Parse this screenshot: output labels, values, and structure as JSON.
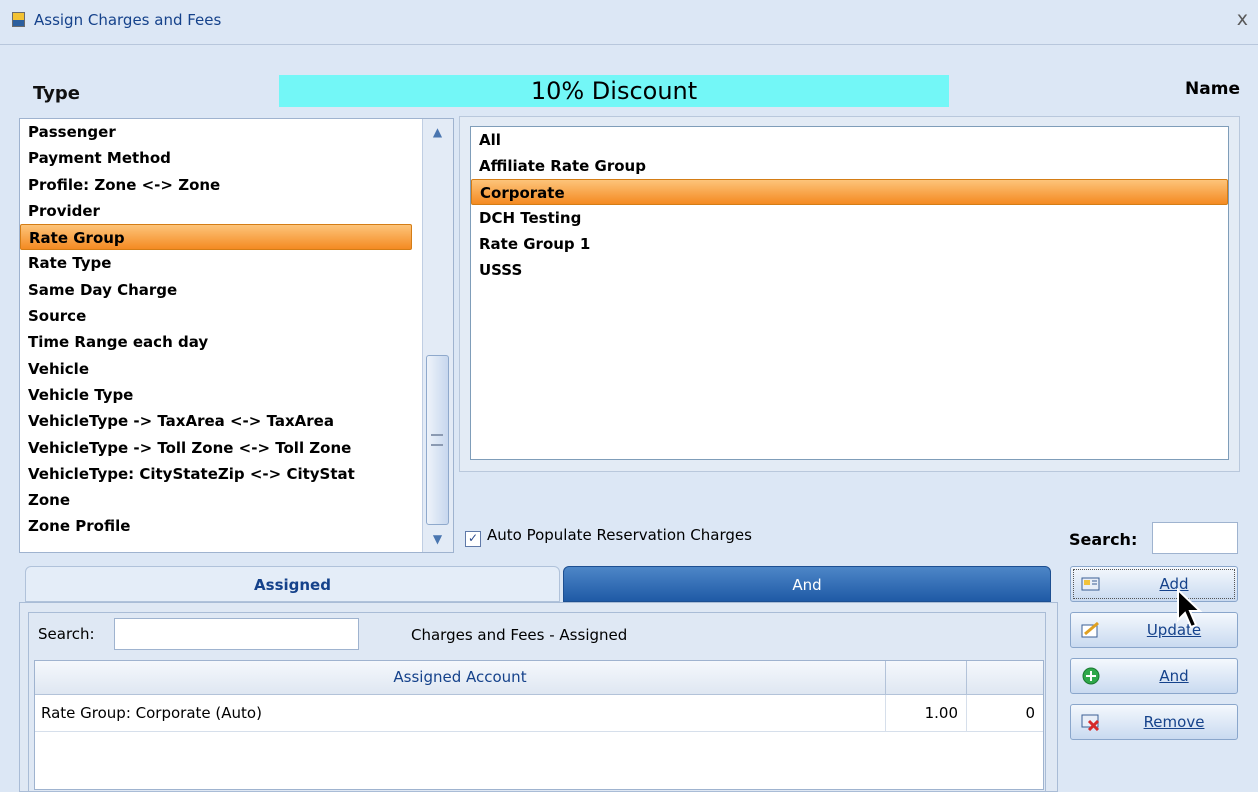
{
  "window": {
    "title": "Assign Charges and Fees",
    "close": "x"
  },
  "header": {
    "type_label": "Type",
    "banner": "10% Discount",
    "name_label": "Name"
  },
  "type_list": {
    "items": [
      "Passenger",
      "Payment Method",
      "Profile: Zone <-> Zone",
      "Provider",
      "Rate Group",
      "Rate Type",
      "Same Day Charge",
      "Source",
      "Time Range each day",
      "Vehicle",
      "Vehicle Type",
      "VehicleType -> TaxArea <-> TaxArea",
      "VehicleType -> Toll Zone <-> Toll Zone",
      "VehicleType: CityStateZip <-> CityStat",
      "Zone",
      "Zone Profile"
    ],
    "selected": "Rate Group"
  },
  "name_list": {
    "items": [
      "All",
      "Affiliate Rate Group",
      "Corporate",
      "DCH Testing",
      "Rate Group 1",
      "USSS"
    ],
    "selected": "Corporate"
  },
  "auto_populate": {
    "label": "Auto Populate Reservation Charges",
    "checked": true
  },
  "search_top": {
    "label": "Search:",
    "value": ""
  },
  "tabs": {
    "assigned": "Assigned",
    "and": "And"
  },
  "assigned_panel": {
    "search_label": "Search:",
    "search_value": "",
    "title": "Charges and Fees - Assigned",
    "columns": [
      "Assigned Account",
      "",
      ""
    ],
    "rows": [
      {
        "account": "Rate Group: Corporate (Auto)",
        "amount": "1.00",
        "count": "0"
      }
    ]
  },
  "buttons": {
    "add": "Add",
    "update": "Update",
    "and": "And",
    "remove": "Remove"
  },
  "icons": {
    "window": "app-icon",
    "add": "add-card-icon",
    "update": "edit-icon",
    "and": "plus-circle-icon",
    "remove": "remove-card-icon"
  },
  "colors": {
    "banner": "#73f7f7",
    "selection": "#f48a22",
    "tab_active": "#1f5aa6"
  }
}
